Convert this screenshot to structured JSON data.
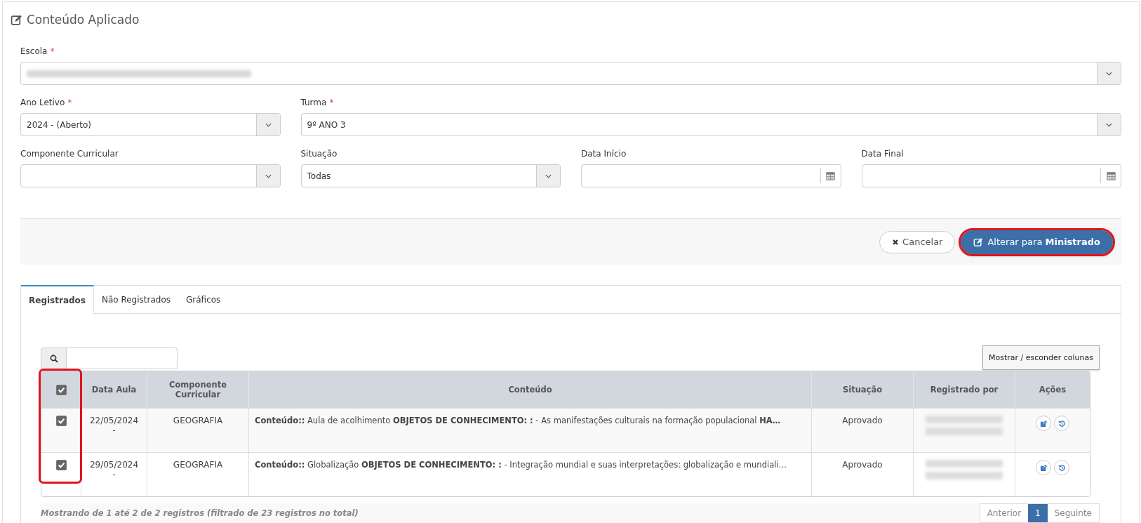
{
  "page": {
    "title": "Conteúdo Aplicado"
  },
  "filters": [
    {
      "kind": "select",
      "label": "Escola",
      "required_mark": "*",
      "value_hidden": true
    },
    {
      "kind": "select",
      "label": "Ano Letivo",
      "required_mark": "*",
      "value": "2024 - (Aberto)"
    },
    {
      "kind": "select",
      "label": "Turma",
      "required_mark": "*",
      "value": "9º ANO 3"
    },
    {
      "kind": "select",
      "label": "Componente Curricular"
    },
    {
      "kind": "select",
      "label": "Situação",
      "value": "Todas"
    },
    {
      "kind": "date",
      "label": "Data Início"
    },
    {
      "kind": "date",
      "label": "Data Final"
    }
  ],
  "actions": [
    {
      "kind": "cancel",
      "label": "Cancelar",
      "highlighted": false
    },
    {
      "kind": "primary",
      "label": "Alterar para **Ministrado**",
      "highlighted": true
    }
  ],
  "tabs": [
    {
      "label": "Registrados",
      "selected": true
    },
    {
      "label": "Não Registrados",
      "selected": false
    },
    {
      "label": "Gráficos",
      "selected": false
    }
  ],
  "toolbar": {
    "columns_button": "Mostrar / esconder colunas"
  },
  "table": {
    "checkbox_column_highlighted": true,
    "select_all_checked": true,
    "columns": [
      "Data Aula",
      "Componente Curricular",
      "Conteúdo",
      "Situação",
      "Registrado por",
      "Ações"
    ],
    "rows": [
      {
        "checked": true,
        "date": "22/05/2024",
        "date_end": "-",
        "component": "GEOGRAFIA",
        "content": "**Conteúdo::** Aula de acolhimento **OBJETOS DE CONHECIMENTO: :** - As manifestações culturais na formação populacional **HA…**",
        "status": "Aprovado",
        "registered_by_hidden": true
      },
      {
        "checked": true,
        "date": "29/05/2024",
        "date_end": "-",
        "component": "GEOGRAFIA",
        "content": "**Conteúdo::** Globalização **OBJETOS DE CONHECIMENTO: :** - Integração mundial e suas interpretações: globalização e mundiali…",
        "status": "Aprovado",
        "registered_by_hidden": true
      }
    ]
  },
  "footer": {
    "info": "Mostrando de 1 até 2 de 2 registros (filtrado de 23 registros no total)",
    "pages": [
      {
        "label": "Anterior",
        "selected": false
      },
      {
        "label": "1",
        "selected": true
      },
      {
        "label": "Seguinte",
        "selected": false
      }
    ]
  }
}
